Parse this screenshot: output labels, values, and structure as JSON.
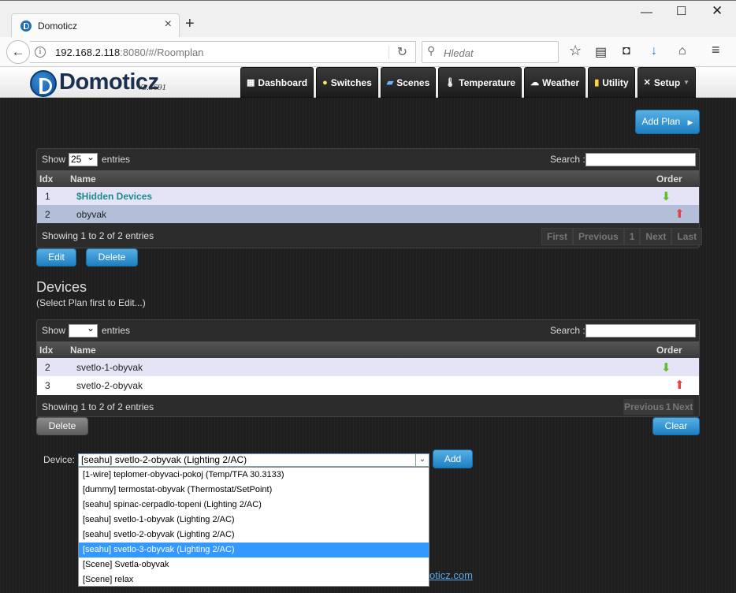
{
  "browser": {
    "tab_title": "Domoticz",
    "url_host": "192.168.2.118",
    "url_rest": ":8080/#/Roomplan",
    "search_placeholder": "Hledat"
  },
  "app": {
    "logo": "Domoticz",
    "version": "V3.5691",
    "menu": [
      {
        "label": "Dashboard",
        "icon": "dashboard-icon"
      },
      {
        "label": "Switches",
        "icon": "bulb-icon"
      },
      {
        "label": "Scenes",
        "icon": "scenes-icon"
      },
      {
        "label": "Temperature",
        "icon": "thermometer-icon"
      },
      {
        "label": "Weather",
        "icon": "weather-icon"
      },
      {
        "label": "Utility",
        "icon": "utility-icon"
      },
      {
        "label": "Setup",
        "icon": "tools-icon"
      }
    ]
  },
  "plans": {
    "add_plan": "Add Plan",
    "show": "Show",
    "page_size": "25",
    "entries": "entries",
    "search_label": "Search :",
    "columns": [
      "Idx",
      "Name",
      "Order"
    ],
    "rows": [
      {
        "idx": "1",
        "name": "$Hidden Devices",
        "order": "down"
      },
      {
        "idx": "2",
        "name": "obyvak",
        "order": "up"
      }
    ],
    "info": "Showing 1 to 2 of 2 entries",
    "pager": [
      "First",
      "Previous",
      "1",
      "Next",
      "Last"
    ],
    "edit": "Edit",
    "delete": "Delete"
  },
  "devices": {
    "title": "Devices",
    "subtitle": "(Select Plan first to Edit...)",
    "show": "Show",
    "page_size": "",
    "entries": "entries",
    "search_label": "Search :",
    "columns": [
      "Idx",
      "Name",
      "Order"
    ],
    "rows": [
      {
        "idx": "2",
        "name": "svetlo-1-obyvak",
        "order": "down"
      },
      {
        "idx": "3",
        "name": "svetlo-2-obyvak",
        "order": "up"
      }
    ],
    "info": "Showing 1 to 2 of 2 entries",
    "pager": [
      "Previous",
      "1",
      "Next"
    ],
    "delete": "Delete",
    "clear": "Clear"
  },
  "add_device": {
    "label": "Device:",
    "selected": "[seahu] svetlo-2-obyvak (Lighting 2/AC)",
    "add": "Add",
    "options": [
      "[1-wire] teplomer-obyvaci-pokoj (Temp/TFA 30.3133)",
      "[dummy] termostat-obyvak (Thermostat/SetPoint)",
      "[seahu] spinac-cerpadlo-topeni (Lighting 2/AC)",
      "[seahu] svetlo-1-obyvak (Lighting 2/AC)",
      "[seahu] svetlo-2-obyvak (Lighting 2/AC)",
      "[seahu] svetlo-3-obyvak (Lighting 2/AC)",
      "[Scene] Svetla-obyvak",
      "[Scene] relax"
    ],
    "highlighted_index": 5
  },
  "footer": {
    "link": "oticz.com"
  }
}
